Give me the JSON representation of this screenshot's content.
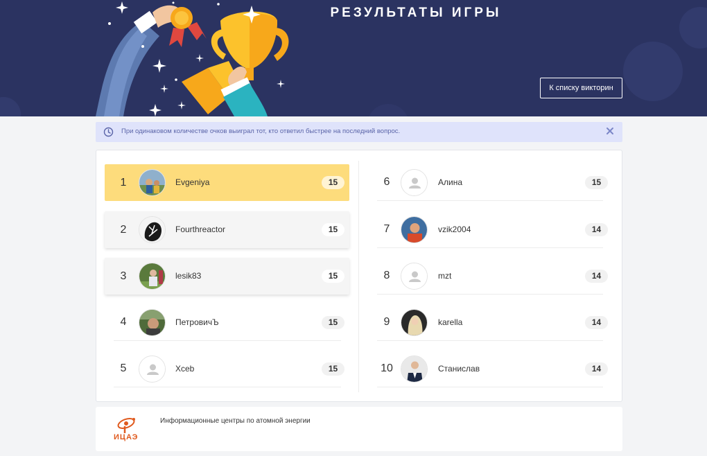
{
  "header": {
    "title": "РЕЗУЛЬТАТЫ ИГРЫ",
    "back_button_label": "К списку викторин",
    "illustration": "trophy-and-medal-illustration"
  },
  "notice": {
    "icon": "clock-icon",
    "text": "При одинаковом количестве очков выиграл тот, кто ответил быстрее на последний вопрос.",
    "close_icon": "close-icon"
  },
  "results": [
    {
      "rank": "1",
      "name": "Evgeniya",
      "score": "15",
      "avatar": "photo"
    },
    {
      "rank": "2",
      "name": "Fourthreactor",
      "score": "15",
      "avatar": "photo"
    },
    {
      "rank": "3",
      "name": "lesik83",
      "score": "15",
      "avatar": "photo"
    },
    {
      "rank": "4",
      "name": "ПетровичЪ",
      "score": "15",
      "avatar": "photo"
    },
    {
      "rank": "5",
      "name": "Xceb",
      "score": "15",
      "avatar": "placeholder"
    },
    {
      "rank": "6",
      "name": "Алина",
      "score": "15",
      "avatar": "placeholder"
    },
    {
      "rank": "7",
      "name": "vzik2004",
      "score": "14",
      "avatar": "photo"
    },
    {
      "rank": "8",
      "name": "mzt",
      "score": "14",
      "avatar": "placeholder"
    },
    {
      "rank": "9",
      "name": "karella",
      "score": "14",
      "avatar": "photo"
    },
    {
      "rank": "10",
      "name": "Станислав",
      "score": "14",
      "avatar": "photo"
    }
  ],
  "footer": {
    "logo_text": "ИЦАЭ",
    "text": "Информационные центры по атомной энергии"
  },
  "colors": {
    "banner": "#2b3361",
    "first_place": "#fddc7c",
    "notice_bg": "#dfe3fb",
    "notice_text": "#5a64a8",
    "logo": "#e05a1e"
  }
}
